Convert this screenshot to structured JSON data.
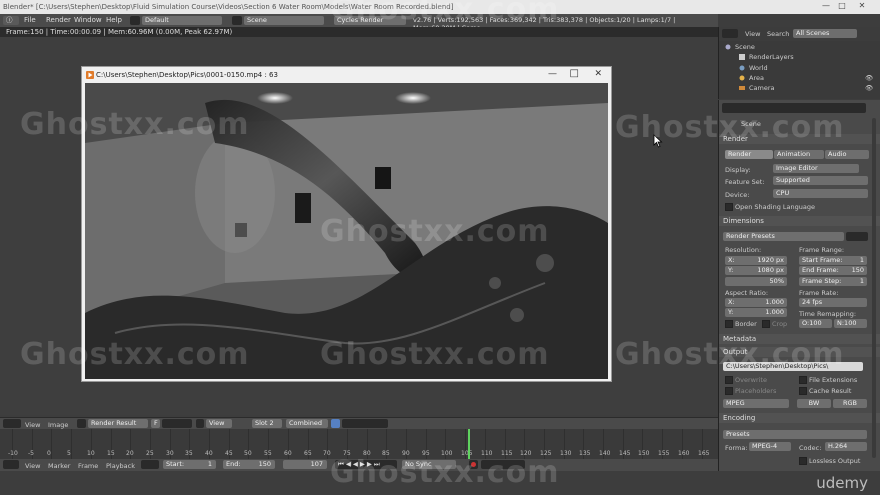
{
  "window": {
    "title": "Blender* [C:\\Users\\Stephen\\Desktop\\Fluid Simulation Course\\Videos\\Section 6 Water Room\\Models\\Water Room Recorded.blend]"
  },
  "menu": {
    "items": [
      "File",
      "Render",
      "Window",
      "Help"
    ],
    "layout": "Default",
    "scene": "Scene",
    "engine": "Cycles Render",
    "stats": "v2.76 | Verts:192,563 | Faces:369,342 | Tris:383,378 | Objects:1/20 | Lamps:1/7 | Mem:60.29M | Came"
  },
  "render_info": "Frame:150 | Time:00:00.09 | Mem:60.96M (0.00M, Peak 62.97M)",
  "player": {
    "title": "C:\\Users\\Stephen\\Desktop\\Pics\\0001-0150.mp4 :   63"
  },
  "image_editor": {
    "view": "View",
    "image": "Image",
    "image_name": "Render Result",
    "f_label": "F",
    "view2": "View",
    "slot": "Slot 2",
    "pass": "Combined"
  },
  "timeline": {
    "ticks": [
      "-10",
      "-5",
      "0",
      "5",
      "10",
      "15",
      "20",
      "25",
      "30",
      "35",
      "40",
      "45",
      "50",
      "55",
      "60",
      "65",
      "70",
      "75",
      "80",
      "85",
      "90",
      "95",
      "100",
      "105",
      "110",
      "115",
      "120",
      "125",
      "130",
      "135",
      "140",
      "145",
      "150",
      "155",
      "160",
      "165"
    ],
    "current_frame_marker": 107,
    "view": "View",
    "marker": "Marker",
    "frame": "Frame",
    "playback": "Playback",
    "start": "Start:",
    "start_val": "1",
    "end": "End:",
    "end_val": "150",
    "current": "107",
    "sync": "No Sync"
  },
  "outliner": {
    "view": "View",
    "search": "Search",
    "filter": "All Scenes",
    "items": [
      "Scene",
      "RenderLayers",
      "World",
      "Area",
      "Camera"
    ]
  },
  "properties": {
    "breadcrumb": "Scene",
    "render_section": "Render",
    "tabs": [
      "Render",
      "Animation",
      "Audio"
    ],
    "display_label": "Display:",
    "display_val": "Image Editor",
    "feature_label": "Feature Set:",
    "feature_val": "Supported",
    "device_label": "Device:",
    "device_val": "CPU",
    "osl": "Open Shading Language",
    "dimensions": "Dimensions",
    "render_presets": "Render Presets",
    "resolution": "Resolution:",
    "res_x": "X:",
    "res_x_val": "1920 px",
    "res_y": "Y:",
    "res_y_val": "1080 px",
    "res_pct": "50%",
    "frame_range": "Frame Range:",
    "start_frame": "Start Frame:",
    "start_frame_val": "1",
    "end_frame": "End Frame:",
    "end_frame_val": "150",
    "frame_step": "Frame Step:",
    "frame_step_val": "1",
    "aspect": "Aspect Ratio:",
    "asp_x": "X:",
    "asp_x_val": "1.000",
    "asp_y": "Y:",
    "asp_y_val": "1.000",
    "frame_rate": "Frame Rate:",
    "fps": "24 fps",
    "time_remap": "Time Remapping:",
    "remap_old": "O:100",
    "remap_new": "N:100",
    "border": "Border",
    "crop": "Crop",
    "metadata": "Metadata",
    "output": "Output",
    "output_path": "C:\\Users\\Stephen\\Desktop\\Pics\\",
    "overwrite": "Overwrite",
    "placeholders": "Placeholders",
    "file_ext": "File Extensions",
    "cache_result": "Cache Result",
    "format": "MPEG",
    "bw": "BW",
    "rgb": "RGB",
    "encoding": "Encoding",
    "presets": "Presets",
    "enc_format_label": "Forma:",
    "enc_format": "MPEG-4",
    "codec_label": "Codec:",
    "codec": "H.264",
    "lossless": "Lossless Output"
  },
  "watermarks": [
    "Ghostxx.com",
    "Ghostxx.com",
    "Ghostxx.com",
    "Ghostxx.com",
    "Ghostxx.com",
    "Ghostxx.com",
    "Ghostxx.com",
    "Ghostxx.com"
  ],
  "udemy": "udemy"
}
